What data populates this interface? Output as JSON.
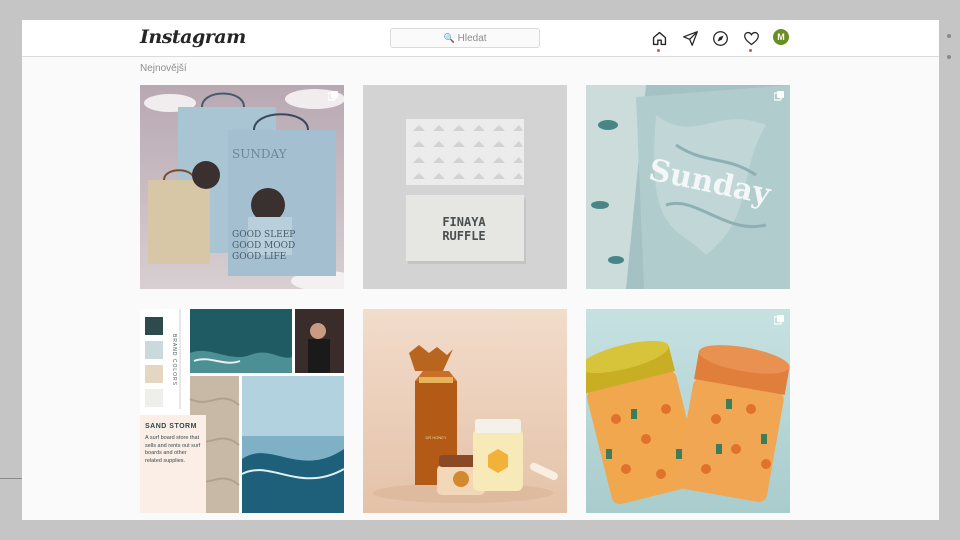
{
  "app": {
    "logo_text": "Instagram"
  },
  "search": {
    "placeholder": "Hledat"
  },
  "nav": {
    "icons": [
      "home-icon",
      "direct-message-icon",
      "explore-icon",
      "activity-heart-icon"
    ],
    "avatar_initial": "M"
  },
  "colors": {
    "notification": "#ed4956",
    "avatar_bg": "#6b8e23",
    "text_primary": "#262626",
    "text_secondary": "#8e8e8e",
    "border": "#dbdbdb"
  },
  "section": {
    "title": "Nejnovější"
  },
  "posts": [
    {
      "multi": true,
      "texts": [
        "SUNDAY",
        "GOOD SLEEP",
        "GOOD MOOD",
        "GOOD LIFE"
      ]
    },
    {
      "multi": false,
      "texts": [
        "FINAYA",
        "RUFFLE"
      ]
    },
    {
      "multi": true,
      "texts": [
        "Sunday"
      ]
    },
    {
      "multi": false,
      "texts": [
        "BRAND COLORS",
        "SAND STORM",
        "A surf board store that sells and rents out surf boards and other related supplies."
      ]
    },
    {
      "multi": false,
      "texts": [
        "DR HONEY"
      ]
    },
    {
      "multi": true,
      "texts": []
    }
  ]
}
